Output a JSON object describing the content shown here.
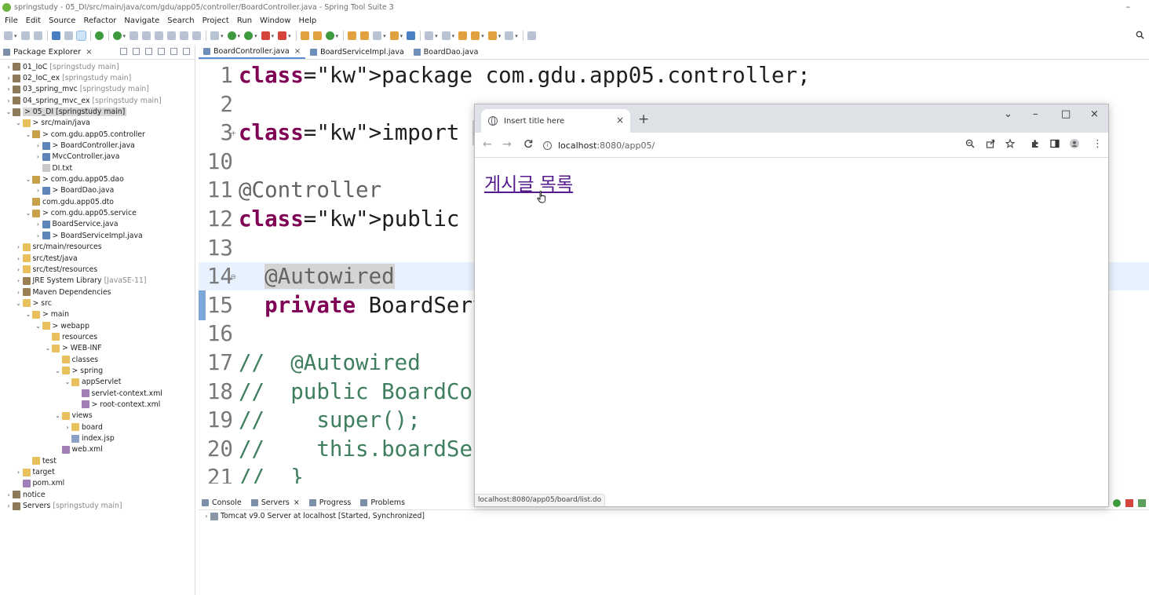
{
  "ide": {
    "window_title": "springstudy - 05_DI/src/main/java/com/gdu/app05/controller/BoardController.java - Spring Tool Suite 3",
    "minimize_glyph": "–",
    "menu": [
      "File",
      "Edit",
      "Source",
      "Refactor",
      "Navigate",
      "Search",
      "Project",
      "Run",
      "Window",
      "Help"
    ]
  },
  "explorer": {
    "tab_label": "Package Explorer",
    "tree": [
      {
        "label": "01_IoC",
        "decor": "[springstudy main]",
        "arrow": "›",
        "icon": "project"
      },
      {
        "label": "02_IoC_ex",
        "decor": "[springstudy main]",
        "arrow": "›",
        "icon": "project"
      },
      {
        "label": "03_spring_mvc",
        "decor": "[springstudy main]",
        "arrow": "›",
        "icon": "project"
      },
      {
        "label": "04_spring_mvc_ex",
        "decor": "[springstudy main]",
        "arrow": "›",
        "icon": "project"
      },
      {
        "label": "> 05_DI [springstudy main]",
        "decor": "",
        "arrow": "⌄",
        "icon": "project",
        "selected": true
      },
      {
        "label": "> src/main/java",
        "decor": "",
        "arrow": "⌄",
        "icon": "folder"
      },
      {
        "label": "> com.gdu.app05.controller",
        "decor": "",
        "arrow": "⌄",
        "icon": "package"
      },
      {
        "label": "> BoardController.java",
        "decor": "",
        "arrow": "›",
        "icon": "java"
      },
      {
        "label": "MvcController.java",
        "decor": "",
        "arrow": "›",
        "icon": "java"
      },
      {
        "label": "DI.txt",
        "decor": "",
        "arrow": "",
        "icon": "file"
      },
      {
        "label": "> com.gdu.app05.dao",
        "decor": "",
        "arrow": "⌄",
        "icon": "package"
      },
      {
        "label": "> BoardDao.java",
        "decor": "",
        "arrow": "›",
        "icon": "java"
      },
      {
        "label": "com.gdu.app05.dto",
        "decor": "",
        "arrow": "",
        "icon": "package"
      },
      {
        "label": "> com.gdu.app05.service",
        "decor": "",
        "arrow": "⌄",
        "icon": "package"
      },
      {
        "label": "BoardService.java",
        "decor": "",
        "arrow": "›",
        "icon": "java"
      },
      {
        "label": "> BoardServiceImpl.java",
        "decor": "",
        "arrow": "›",
        "icon": "java"
      },
      {
        "label": "src/main/resources",
        "decor": "",
        "arrow": "›",
        "icon": "folder"
      },
      {
        "label": "src/test/java",
        "decor": "",
        "arrow": "›",
        "icon": "folder"
      },
      {
        "label": "src/test/resources",
        "decor": "",
        "arrow": "›",
        "icon": "folder"
      },
      {
        "label": "JRE System Library",
        "decor": "[JavaSE-11]",
        "arrow": "›",
        "icon": "lib"
      },
      {
        "label": "Maven Dependencies",
        "decor": "",
        "arrow": "›",
        "icon": "lib"
      },
      {
        "label": "> src",
        "decor": "",
        "arrow": "⌄",
        "icon": "folder"
      },
      {
        "label": "> main",
        "decor": "",
        "arrow": "⌄",
        "icon": "folder"
      },
      {
        "label": "> webapp",
        "decor": "",
        "arrow": "⌄",
        "icon": "folder"
      },
      {
        "label": "resources",
        "decor": "",
        "arrow": "",
        "icon": "folder"
      },
      {
        "label": "> WEB-INF",
        "decor": "",
        "arrow": "⌄",
        "icon": "folder"
      },
      {
        "label": "classes",
        "decor": "",
        "arrow": "",
        "icon": "folder"
      },
      {
        "label": "> spring",
        "decor": "",
        "arrow": "⌄",
        "icon": "folder"
      },
      {
        "label": "appServlet",
        "decor": "",
        "arrow": "⌄",
        "icon": "folder"
      },
      {
        "label": "servlet-context.xml",
        "decor": "",
        "arrow": "",
        "icon": "xml"
      },
      {
        "label": "> root-context.xml",
        "decor": "",
        "arrow": "",
        "icon": "xml"
      },
      {
        "label": "views",
        "decor": "",
        "arrow": "⌄",
        "icon": "folder"
      },
      {
        "label": "board",
        "decor": "",
        "arrow": "›",
        "icon": "folder"
      },
      {
        "label": "index.jsp",
        "decor": "",
        "arrow": "",
        "icon": "jsp"
      },
      {
        "label": "web.xml",
        "decor": "",
        "arrow": "",
        "icon": "xml"
      },
      {
        "label": "test",
        "decor": "",
        "arrow": "",
        "icon": "folder"
      },
      {
        "label": "target",
        "decor": "",
        "arrow": "›",
        "icon": "folder"
      },
      {
        "label": "pom.xml",
        "decor": "",
        "arrow": "",
        "icon": "xml"
      },
      {
        "label": "notice",
        "decor": "",
        "arrow": "›",
        "icon": "project"
      },
      {
        "label": "Servers",
        "decor": "[springstudy main]",
        "arrow": "›",
        "icon": "project"
      }
    ]
  },
  "editor_tabs": [
    {
      "label": "BoardController.java",
      "active": true
    },
    {
      "label": "BoardServiceImpl.java",
      "active": false
    },
    {
      "label": "BoardDao.java",
      "active": false
    }
  ],
  "code": [
    {
      "ln": "1",
      "code": "package com.gdu.app05.controller;"
    },
    {
      "ln": "2",
      "code": ""
    },
    {
      "ln": "3",
      "fold": "+",
      "code": "import org.springfr"
    },
    {
      "ln": "10",
      "code": ""
    },
    {
      "ln": "11",
      "code": "@Controller"
    },
    {
      "ln": "12",
      "code": "public class BoardC"
    },
    {
      "ln": "13",
      "code": ""
    },
    {
      "ln": "14",
      "fold": "⊖",
      "code": "  @Autowired"
    },
    {
      "ln": "15",
      "code": "  private BoardServ"
    },
    {
      "ln": "16",
      "code": ""
    },
    {
      "ln": "17",
      "code": "//  @Autowired"
    },
    {
      "ln": "18",
      "code": "//  public BoardCon"
    },
    {
      "ln": "19",
      "code": "//    super();"
    },
    {
      "ln": "20",
      "code": "//    this.boardSer"
    },
    {
      "ln": "21",
      "code": "//  }"
    }
  ],
  "console": {
    "tabs": [
      "Console",
      "Servers",
      "Progress",
      "Problems"
    ],
    "server_row": "Tomcat v9.0 Server at localhost  [Started, Synchronized]"
  },
  "browser": {
    "tab_title": "Insert title here",
    "url_host": "localhost",
    "url_path": ":8080/app05/",
    "link_text": "게시글 목록",
    "status_url": "localhost:8080/app05/board/list.do",
    "new_tab_glyph": "+",
    "tab_close_glyph": "×",
    "back_glyph": "←",
    "forward_glyph": "→",
    "reload_glyph": "C",
    "more_glyph": "⋮",
    "window_controls": {
      "list": "⌄",
      "minimize": "–",
      "maximize": "□",
      "close": "×"
    }
  }
}
